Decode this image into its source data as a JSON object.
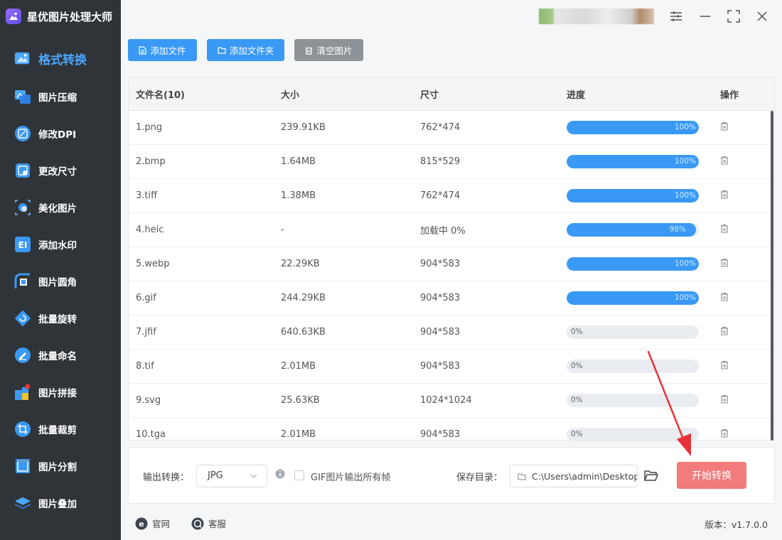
{
  "app": {
    "title": "星优图片处理大师"
  },
  "sidebar": {
    "active": {
      "label": "格式转换",
      "icon": "image-convert-icon"
    },
    "items": [
      {
        "label": "图片压缩",
        "icon": "compress-icon"
      },
      {
        "label": "修改DPI",
        "icon": "dpi-icon"
      },
      {
        "label": "更改尺寸",
        "icon": "resize-icon"
      },
      {
        "label": "美化图片",
        "icon": "beautify-icon"
      },
      {
        "label": "添加水印",
        "icon": "watermark-icon"
      },
      {
        "label": "图片圆角",
        "icon": "round-corner-icon"
      },
      {
        "label": "批量旋转",
        "icon": "rotate-icon"
      },
      {
        "label": "批量命名",
        "icon": "rename-icon"
      },
      {
        "label": "图片拼接",
        "icon": "puzzle-icon"
      },
      {
        "label": "批量裁剪",
        "icon": "crop-icon"
      },
      {
        "label": "图片分割",
        "icon": "split-icon"
      },
      {
        "label": "图片叠加",
        "icon": "layers-icon"
      }
    ]
  },
  "toolbar": {
    "add_file": "添加文件",
    "add_folder": "添加文件夹",
    "clear": "清空图片"
  },
  "table": {
    "headers": {
      "name": "文件名(10)",
      "size": "大小",
      "dim": "尺寸",
      "progress": "进度",
      "op": "操作"
    },
    "rows": [
      {
        "name": "1.png",
        "size": "239.91KB",
        "dim": "762*474",
        "progress": 100,
        "pct": "100%"
      },
      {
        "name": "2.bmp",
        "size": "1.64MB",
        "dim": "815*529",
        "progress": 100,
        "pct": "100%"
      },
      {
        "name": "3.tiff",
        "size": "1.38MB",
        "dim": "762*474",
        "progress": 100,
        "pct": "100%"
      },
      {
        "name": "4.heic",
        "size": "-",
        "dim": "加载中 0%",
        "progress": 98,
        "pct": "98%"
      },
      {
        "name": "5.webp",
        "size": "22.29KB",
        "dim": "904*583",
        "progress": 100,
        "pct": "100%"
      },
      {
        "name": "6.gif",
        "size": "244.29KB",
        "dim": "904*583",
        "progress": 100,
        "pct": "100%"
      },
      {
        "name": "7.jfif",
        "size": "640.63KB",
        "dim": "904*583",
        "progress": 0,
        "pct": "0%"
      },
      {
        "name": "8.tif",
        "size": "2.01MB",
        "dim": "904*583",
        "progress": 0,
        "pct": "0%"
      },
      {
        "name": "9.svg",
        "size": "25.63KB",
        "dim": "1024*1024",
        "progress": 0,
        "pct": "0%"
      },
      {
        "name": "10.tga",
        "size": "2.01MB",
        "dim": "904*583",
        "progress": 0,
        "pct": "0%"
      }
    ]
  },
  "bottom": {
    "output_label": "输出转换：",
    "format": "JPG",
    "gif_label": "GIF图片输出所有帧",
    "save_label": "保存目录：",
    "save_path": "C:\\Users\\admin\\Desktop",
    "start": "开始转换"
  },
  "footer": {
    "website": "官网",
    "service": "客服",
    "version": "版本：v1.7.0.0"
  },
  "colors": {
    "accent": "#3a99f4",
    "sidebar": "#2f3439",
    "start": "#f27b7b",
    "arrow": "#e8333a"
  }
}
